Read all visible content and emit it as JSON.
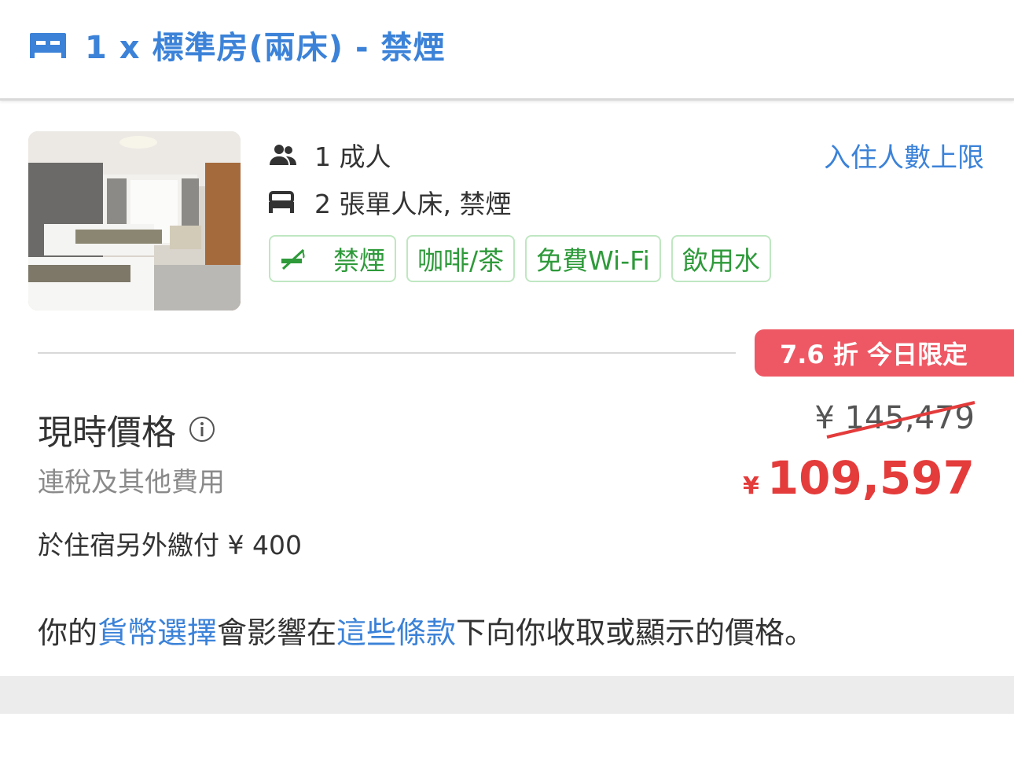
{
  "header": {
    "title": "1 x 標準房(兩床) - 禁煙",
    "icon": "bed-icon"
  },
  "room": {
    "guests": "1 成人",
    "beds": "2 張單人床, 禁煙",
    "occupancy_link": "入住人數上限",
    "tags": [
      {
        "label": "禁煙",
        "icon": "no-smoking-icon"
      },
      {
        "label": "咖啡/茶"
      },
      {
        "label": "免費Wi-Fi"
      },
      {
        "label": "飲用水"
      }
    ]
  },
  "pricing": {
    "badge": "7.6 折 今日限定",
    "label": "現時價格",
    "tax_note": "連稅及其他費用",
    "old_price": "¥ 145,479",
    "currency": "¥",
    "new_price": "109,597",
    "extra_fee": "於住宿另外繳付 ¥ 400"
  },
  "disclaimer": {
    "part1": "你的",
    "link1": "貨幣選擇",
    "part2": "會影響在",
    "link2": "這些條款",
    "part3": "下向你收取或顯示的價格。"
  },
  "colors": {
    "accent": "#3b82d8",
    "price_red": "#e43b3b",
    "badge_red": "#ee5864",
    "tag_green": "#2e9a3a"
  }
}
